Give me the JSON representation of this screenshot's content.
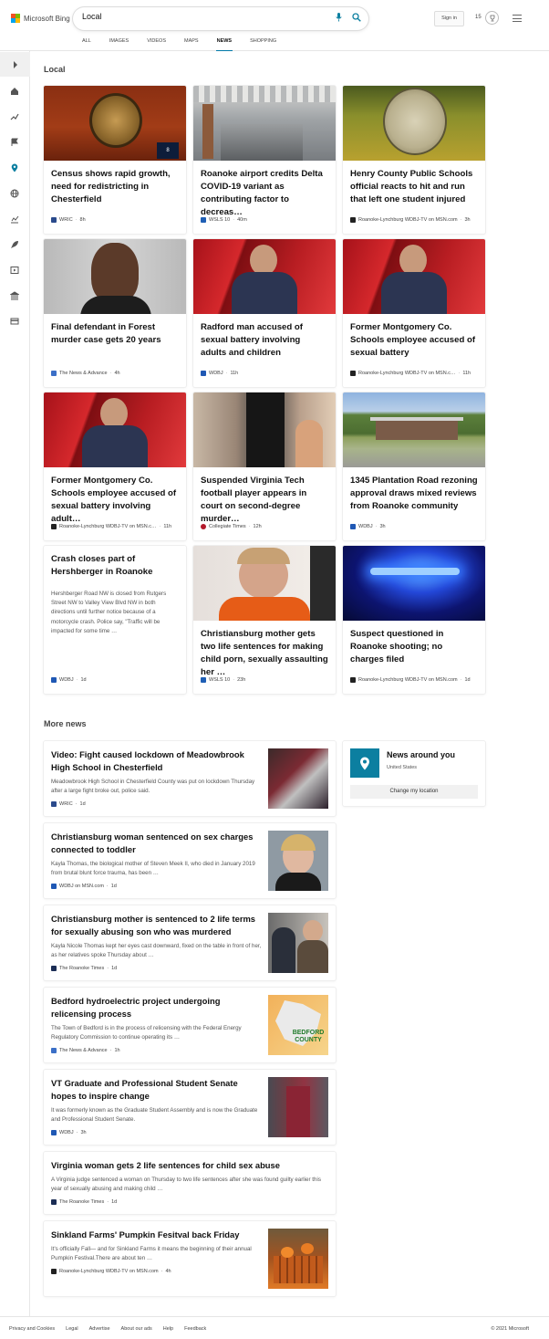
{
  "header": {
    "logo_text": "Microsoft Bing",
    "search_value": "Local",
    "sign_in": "Sign in",
    "rewards_count": "15",
    "tabs": [
      "ALL",
      "IMAGES",
      "VIDEOS",
      "MAPS",
      "NEWS",
      "SHOPPING"
    ]
  },
  "local": {
    "title": "Local",
    "cards": [
      {
        "title": "Census shows rapid growth, need for redistricting in Chesterfield",
        "source": "WRIC",
        "time": "8h"
      },
      {
        "title": "Roanoke airport credits Delta COVID-19 variant as contributing factor to decreas…",
        "source": "WSLS 10",
        "time": "40m"
      },
      {
        "title": "Henry County Public Schools official reacts to hit and run that left one student injured",
        "source": "Roanoke-Lynchburg WDBJ-TV on MSN.com",
        "time": "3h"
      },
      {
        "title": "Final defendant in Forest murder case gets 20 years",
        "source": "The News & Advance",
        "time": "4h"
      },
      {
        "title": "Radford man accused of sexual battery involving adults and children",
        "source": "WDBJ",
        "time": "11h"
      },
      {
        "title": "Former Montgomery Co. Schools employee accused of sexual battery",
        "source": "Roanoke-Lynchburg WDBJ-TV on MSN.c…",
        "time": "11h"
      },
      {
        "title": "Former Montgomery Co. Schools employee accused of sexual battery involving adult…",
        "source": "Roanoke-Lynchburg WDBJ-TV on MSN.c…",
        "time": "11h"
      },
      {
        "title": "Suspended Virginia Tech football player appears in court on second-degree murder…",
        "source": "Collegiate Times",
        "time": "12h"
      },
      {
        "title": "1345 Plantation Road rezoning approval draws mixed reviews from Roanoke community",
        "source": "WDBJ",
        "time": "3h"
      },
      {
        "title": "Crash closes part of Hershberger in Roanoke",
        "snippet": "Hershberger Road NW is closed from Rutgers Street NW to Valley View Blvd NW in both directions until further notice because of a motorcycle crash. Police say, \"Traffic will be impacted for some time …",
        "source": "WDBJ",
        "time": "1d"
      },
      {
        "title": "Christiansburg mother gets two life sentences for making child porn, sexually assaulting her …",
        "source": "WSLS 10",
        "time": "23h"
      },
      {
        "title": "Suspect questioned in Roanoke shooting; no charges filed",
        "source": "Roanoke-Lynchburg WDBJ-TV on MSN.com",
        "time": "1d"
      }
    ]
  },
  "more_news": {
    "title": "More news",
    "items": [
      {
        "title": "Video: Fight caused lockdown of Meadowbrook High School in Chesterfield",
        "snippet": "Meadowbrook High School in Chesterfield County was put on lockdown Thursday after a large fight broke out, police said.",
        "source": "WRIC",
        "time": "1d"
      },
      {
        "title": "Christiansburg woman sentenced on sex charges connected to toddler",
        "snippet": "Kayla Thomas, the biological mother of Steven Meek II, who died in January 2019 from brutal blunt force trauma, has been …",
        "source": "WDBJ on MSN.com",
        "time": "1d"
      },
      {
        "title": "Christiansburg mother is sentenced to 2 life terms for sexually abusing son who was murdered",
        "snippet": "Kayla Nicole Thomas kept her eyes cast downward, fixed on the table in front of her, as her relatives spoke Thursday about …",
        "source": "The Roanoke Times",
        "time": "1d"
      },
      {
        "title": "Bedford hydroelectric project undergoing relicensing process",
        "snippet": "The Town of Bedford is in the process of relicensing with the Federal Energy Regulatory Commission to continue operating its …",
        "source": "The News & Advance",
        "time": "1h"
      },
      {
        "title": "VT Graduate and Professional Student Senate hopes to inspire change",
        "snippet": "It was formerly known as the Graduate Student Assembly and is now the Graduate and Professional Student Senate.",
        "source": "WDBJ",
        "time": "3h"
      },
      {
        "title": "Virginia woman gets 2 life sentences for child sex abuse",
        "snippet": "A Virginia judge sentenced a woman on Thursday to two life sentences after she was found guilty earlier this year of sexually abusing and making child …",
        "source": "The Roanoke Times",
        "time": "1d"
      },
      {
        "title": "Sinkland Farms' Pumpkin Fesitval back Friday",
        "snippet": "It's officially Fall— and for Sinkland Farms it means the beginning of their annual Pumpkin Festival.There are about ten …",
        "source": "Roanoke-Lynchburg WDBJ-TV on MSN.com",
        "time": "4h"
      }
    ],
    "bedford_label": "BEDFORD COUNTY"
  },
  "around": {
    "title": "News around you",
    "location": "United States",
    "button": "Change my location"
  },
  "footer": {
    "links": [
      "Privacy and Cookies",
      "Legal",
      "Advertise",
      "About our ads",
      "Help",
      "Feedback"
    ],
    "copyright": "© 2021 Microsoft"
  },
  "colors": {
    "accent": "#0078a8",
    "location_tile": "#0c7fa0"
  }
}
